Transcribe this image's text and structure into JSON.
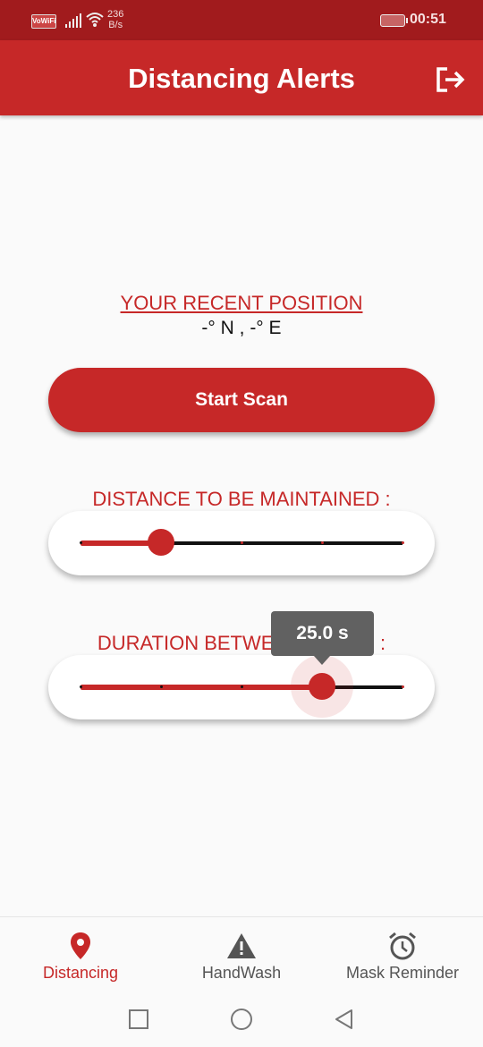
{
  "status_bar": {
    "wifi_badge": "VoWiFi",
    "speed_value": "236",
    "speed_unit": "B/s",
    "time": "00:51"
  },
  "app_bar": {
    "title": "Distancing Alerts",
    "logout_icon": "logout-icon"
  },
  "position": {
    "label": "YOUR RECENT POSITION",
    "value": "-° N , -° E"
  },
  "scan_button": {
    "label": "Start Scan"
  },
  "distance_slider": {
    "label": "DISTANCE TO BE MAINTAINED :",
    "value_fraction": 0.25,
    "divisions": 4
  },
  "duration_slider": {
    "label": "DURATION BETWEEN SCANS :",
    "value_fraction": 0.75,
    "divisions": 4,
    "tooltip": "25.0 s"
  },
  "bottom_nav": {
    "items": [
      {
        "label": "Distancing",
        "icon": "location-pin-icon",
        "active": true
      },
      {
        "label": "HandWash",
        "icon": "warning-icon",
        "active": false
      },
      {
        "label": "Mask Reminder",
        "icon": "alarm-clock-icon",
        "active": false
      }
    ]
  },
  "colors": {
    "primary": "#c62828",
    "status_bar": "#a11b1d",
    "tooltip": "#616161"
  }
}
